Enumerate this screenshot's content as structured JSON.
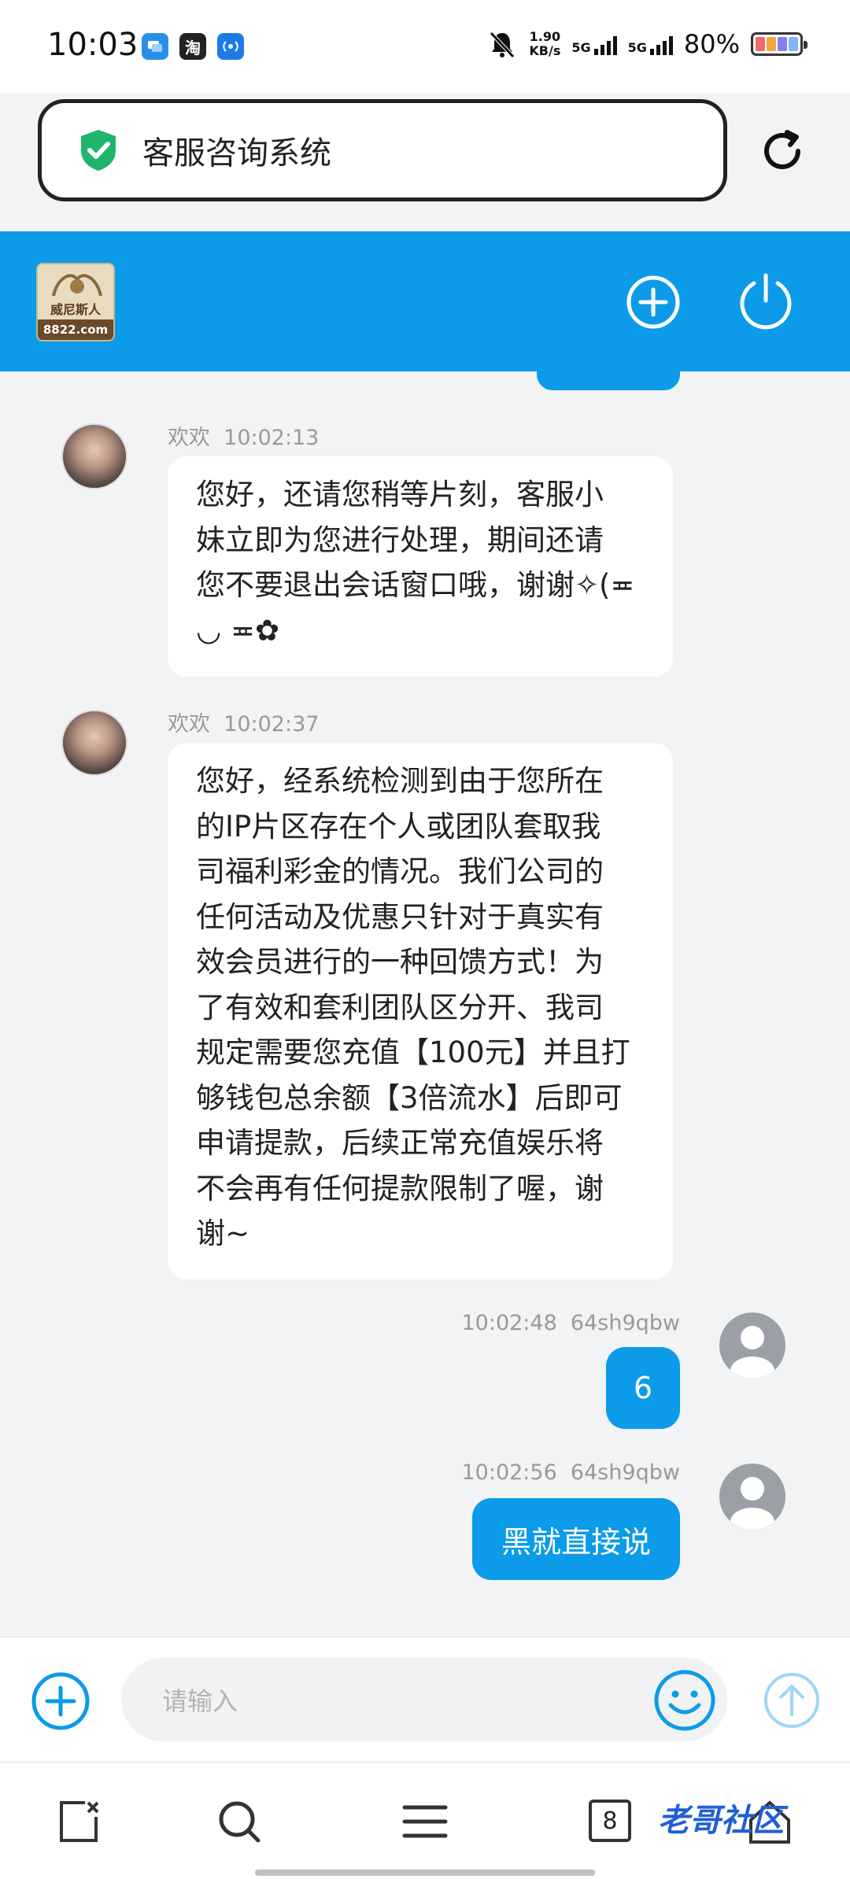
{
  "status_bar": {
    "time": "10:03",
    "app_icons": [
      "chat-app-icon",
      "taobao-icon",
      "hotspot-icon"
    ],
    "taobao_glyph": "淘",
    "speed_value": "1.90",
    "speed_unit": "KB/s",
    "net1": "5G",
    "net2": "5G",
    "battery": "80%",
    "battery_colors": [
      "#f26b6b",
      "#f2a93b",
      "#8a7cf0",
      "#7fb6f5"
    ]
  },
  "address_bar": {
    "title": "客服咨询系统",
    "shield_color": "#1fb56b"
  },
  "header": {
    "logo_name": "威尼斯人",
    "logo_domain": "8822.com",
    "accent": "#0b9be8"
  },
  "messages": [
    {
      "side": "left",
      "sender": "欢欢",
      "time": "10:02:13",
      "lines": [
        "您好，还请您稍等片刻，客服小",
        "妹立即为您进行处理，期间还请",
        "您不要退出会话窗口哦，谢谢✧(≖",
        "◡ ≖✿"
      ]
    },
    {
      "side": "left",
      "sender": "欢欢",
      "time": "10:02:37",
      "lines": [
        "您好，经系统检测到由于您所在",
        "的IP片区存在个人或团队套取我",
        "司福利彩金的情况。我们公司的",
        "任何活动及优惠只针对于真实有",
        "效会员进行的一种回馈方式！为",
        "了有效和套利团队区分开、我司",
        "规定需要您充值【100元】并且打",
        "够钱包总余额【3倍流水】后即可",
        "申请提款，后续正常充值娱乐将",
        "不会再有任何提款限制了喔，谢",
        "谢~"
      ]
    },
    {
      "side": "right",
      "sender": "64sh9qbw",
      "time": "10:02:48",
      "text": "6"
    },
    {
      "side": "right",
      "sender": "64sh9qbw",
      "time": "10:02:56",
      "text": "黑就直接说"
    }
  ],
  "input": {
    "placeholder": "请输入"
  },
  "nav": {
    "tab_count": "8",
    "watermark": "老哥社区"
  }
}
